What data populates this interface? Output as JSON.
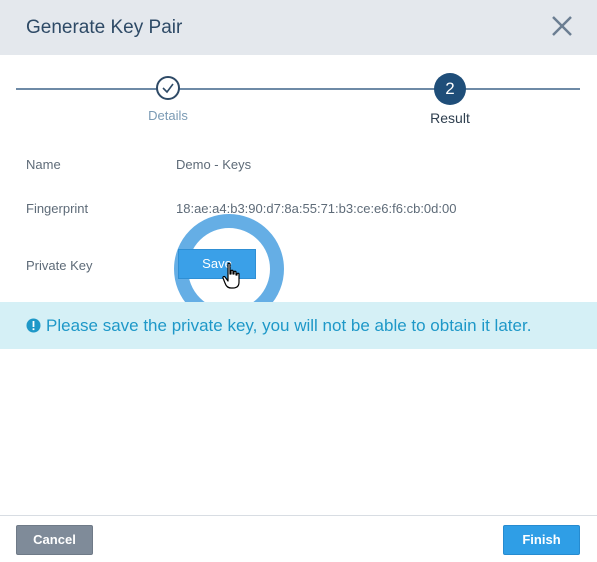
{
  "dialog": {
    "title": "Generate Key Pair",
    "close_icon": "close-icon"
  },
  "stepper": {
    "steps": [
      {
        "label": "Details",
        "status": "completed",
        "icon": "check-icon"
      },
      {
        "label": "Result",
        "number": "2",
        "status": "active"
      }
    ]
  },
  "form": {
    "name_label": "Name",
    "name_value": "Demo - Keys",
    "fingerprint_label": "Fingerprint",
    "fingerprint_value": "18:ae:a4:b3:90:d7:8a:55:71:b3:ce:e6:f6:cb:0d:00",
    "private_key_label": "Private Key",
    "save_label": "Save"
  },
  "alert": {
    "icon": "exclamation-circle-icon",
    "text": "Please save the private key, you will not be able to obtain it later."
  },
  "footer": {
    "cancel_label": "Cancel",
    "finish_label": "Finish"
  },
  "colors": {
    "header_bg": "#e4e8ed",
    "primary": "#2f9ee6",
    "step_active": "#1f4e79",
    "alert_bg": "#d5f0f6",
    "alert_text": "#1e98c8",
    "cancel_bg": "#7f8b99"
  }
}
